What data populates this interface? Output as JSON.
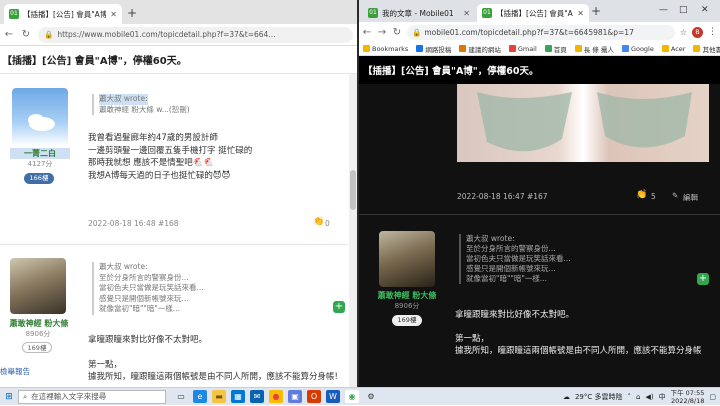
{
  "left_browser": {
    "tab_title": "【插播】[公告] 會員\"A博\"，停權60",
    "tab_favicon": "01",
    "address": "https://www.mobile01.com/topicdetail.php?f=37&t=664...",
    "topic_title": "【插播】[公告] 會員\"A博\"，停權60天。",
    "posts": [
      {
        "username": "一菁二白",
        "points": "4127分",
        "badge": "166樓",
        "quote_author": "蕭大叔 wrote:",
        "quote_line": "蕭敢神經 粉大條 w...(恕刪)",
        "lines": [
          "我曾看過髮廊年約47歲的男設計師",
          "一邊剪頭髮一邊回覆五隻手機打字 挺忙碌的",
          "那時我就想 應該不是情聖吧🐔🐔",
          "我想A博每天過的日子也挺忙碌的😈😈"
        ],
        "meta": "2022-08-18 16:48 #168",
        "likes": "0"
      },
      {
        "username": "蕭敢神經 粉大條",
        "points": "8906分",
        "badge": "169樓",
        "quote_author": "蕭大叔 wrote:",
        "quote_lines": [
          "至於分身所言的警察身份...",
          "當初色夫只當做是玩笑話來看...",
          "感覺只是開個新帳號來玩...",
          "就像當初\"暗\"\"暗\"一樣..."
        ],
        "lines": [
          "拿曈跟瞳來對比好像不太對吧。",
          "",
          "第一點，",
          "據我所知，曈跟瞳這兩個帳號是由不同人所開，應該不能算分身帳!"
        ]
      }
    ],
    "side_link": "檢舉報告"
  },
  "right_browser": {
    "tabs": [
      {
        "title": "我的文章 - Mobile01",
        "favicon": "01"
      },
      {
        "title": "【插播】[公告] 會員\"A博\"，停權",
        "favicon": "01"
      }
    ],
    "address": "mobile01.com/topicdetail.php?f=37&t=6645981&p=17",
    "profile_initial": "B",
    "bookmarks": [
      "Bookmarks",
      "網路投稿",
      "建議的網站",
      "Gmail",
      "首頁",
      "長 條 攝人",
      "Google",
      "Acer",
      "其他書籤"
    ],
    "topic_title": "【插播】[公告] 會員\"A博\"，停權60天。",
    "post167": {
      "meta": "2022-08-18 16:47 #167",
      "likes": "5",
      "edit": "編輯"
    },
    "post169": {
      "username": "蕭敢神經 粉大條",
      "points": "8906分",
      "badge": "169樓",
      "quote_author": "蕭大叔 wrote:",
      "quote_lines": [
        "至於分身所言的警察身份...",
        "當初色夫只當做是玩笑話來看...",
        "感覺只是開個新帳號來玩...",
        "就像當初\"暗\"\"暗\"一樣..."
      ],
      "lines": [
        "拿曈跟瞳來對比好像不太對吧。",
        "",
        "第一點，",
        "據我所知，曈跟瞳這兩個帳號是由不同人所開，應該不能算分身帳"
      ]
    }
  },
  "taskbar": {
    "search_placeholder": "在這裡輸入文字來搜尋",
    "weather": "29°C 多雲時陰",
    "time": "下午 07:55",
    "date": "2022/8/18"
  },
  "colors": {
    "accent_green": "#2fa84f",
    "badge_blue": "#3f6ea8"
  }
}
